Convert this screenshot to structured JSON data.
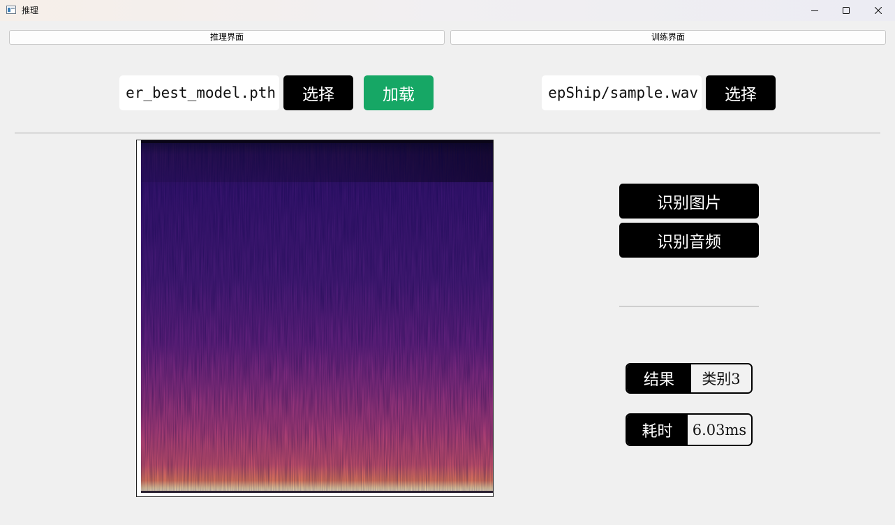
{
  "window": {
    "title": "推理",
    "controls": {
      "minimize": "minimize-icon",
      "maximize": "maximize-icon",
      "close": "close-icon"
    }
  },
  "tabs": [
    {
      "label": "推理界面"
    },
    {
      "label": "训练界面"
    }
  ],
  "model": {
    "path": "er_best_model.pth",
    "select_label": "选择",
    "load_label": "加载"
  },
  "audio": {
    "path": "epShip/sample.wav",
    "select_label": "选择"
  },
  "actions": {
    "recognize_image_label": "识别图片",
    "recognize_audio_label": "识别音频"
  },
  "result": {
    "label": "结果",
    "value": "类别3"
  },
  "elapsed": {
    "label": "耗时",
    "value": "6.03ms"
  },
  "colors": {
    "load_button": "#16a765",
    "dark_button": "#000000",
    "background": "#f0f0f0"
  }
}
